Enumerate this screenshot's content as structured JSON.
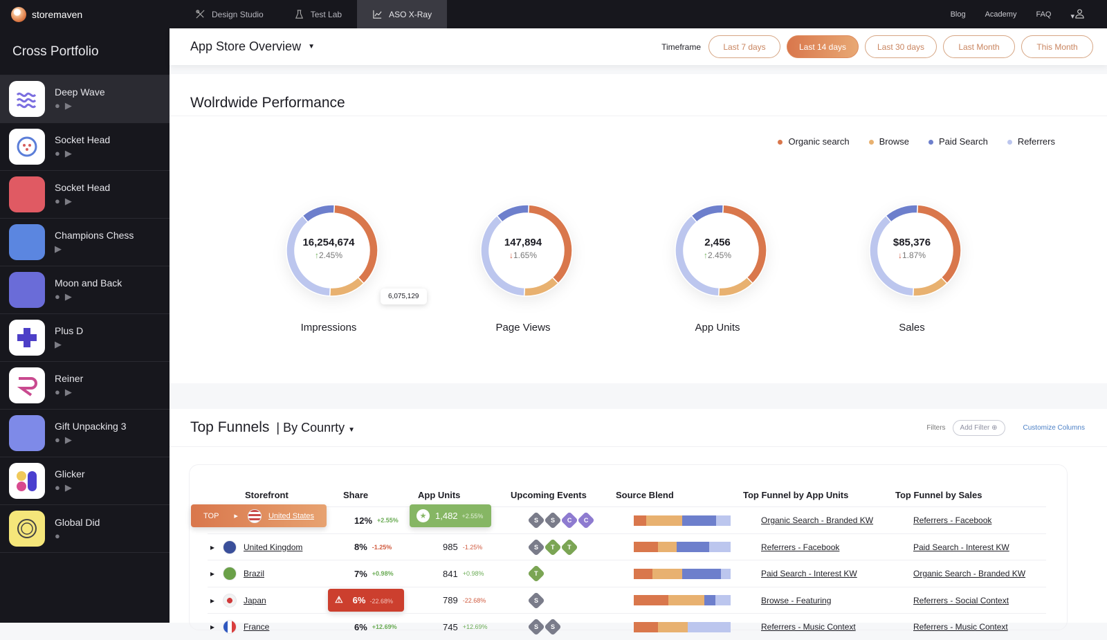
{
  "topbar": {
    "brand": "storemaven",
    "tabs": [
      {
        "label": "Design Studio",
        "icon": "design-studio-icon"
      },
      {
        "label": "Test Lab",
        "icon": "flask-icon"
      },
      {
        "label": "ASO X-Ray",
        "icon": "chart-line-icon",
        "active": true
      }
    ],
    "links": [
      "Blog",
      "Academy",
      "FAQ"
    ]
  },
  "sidebar": {
    "title": "Cross Portfolio",
    "apps": [
      {
        "name": "Deep Wave",
        "platforms": [
          "ios",
          "android"
        ],
        "active": true
      },
      {
        "name": "Socket Head",
        "platforms": [
          "ios",
          "android"
        ]
      },
      {
        "name": "Socket Head",
        "platforms": [
          "ios",
          "android"
        ]
      },
      {
        "name": "Champions Chess",
        "platforms": [
          "android"
        ]
      },
      {
        "name": "Moon and Back",
        "platforms": [
          "ios",
          "android"
        ]
      },
      {
        "name": "Plus D",
        "platforms": [
          "android"
        ]
      },
      {
        "name": "Reiner",
        "platforms": [
          "ios",
          "android"
        ]
      },
      {
        "name": "Gift Unpacking 3",
        "platforms": [
          "ios",
          "android"
        ]
      },
      {
        "name": "Glicker",
        "platforms": [
          "ios",
          "android"
        ]
      },
      {
        "name": "Global Did",
        "platforms": [
          "ios"
        ]
      }
    ]
  },
  "header": {
    "title": "App Store Overview",
    "timeframe_label": "Timeframe",
    "timeframes": [
      "Last 7 days",
      "Last 14 days",
      "Last 30 days",
      "Last Month",
      "This Month"
    ],
    "active_timeframe": "Last 14 days"
  },
  "performance": {
    "title": "Wolrdwide Performance",
    "tooltip": "6,075,129"
  },
  "chart_data": {
    "type": "pie",
    "legend": [
      {
        "name": "Organic search",
        "color": "#d9774c"
      },
      {
        "name": "Browse",
        "color": "#e8b170"
      },
      {
        "name": "Paid Search",
        "color": "#6d7fcc"
      },
      {
        "name": "Referrers",
        "color": "#bcc6ee"
      }
    ],
    "legend_position": "top-right",
    "charts": [
      {
        "label": "Impressions",
        "total": "16,254,674",
        "change": "2.45%",
        "direction": "up",
        "shares": [
          37,
          13,
          12,
          38
        ]
      },
      {
        "label": "Page Views",
        "total": "147,894",
        "change": "1.65%",
        "direction": "down",
        "shares": [
          37,
          13,
          12,
          38
        ]
      },
      {
        "label": "App Units",
        "total": "2,456",
        "change": "2.45%",
        "direction": "up",
        "shares": [
          37,
          13,
          12,
          38
        ]
      },
      {
        "label": "Sales",
        "total": "$85,376",
        "change": "1.87%",
        "direction": "down",
        "shares": [
          37,
          13,
          12,
          38
        ]
      }
    ]
  },
  "funnels": {
    "title": "Top Funnels",
    "subtitle": "By Counrty",
    "filters_label": "Filters",
    "add_filter": "Add Filter",
    "customize": "Customize Columns",
    "columns": [
      "Storefront",
      "Share",
      "App Units",
      "Upcoming Events",
      "Source Blend",
      "Top Funnel by App Units",
      "Top Funnel by Sales"
    ],
    "top_label": "TOP",
    "rows": [
      {
        "country": "United States",
        "share": "12%",
        "share_chg": "+2.55%",
        "units": "1,482",
        "units_chg": "+2.55%",
        "events": [
          "S",
          "S",
          "C",
          "C"
        ],
        "blend": [
          13,
          37,
          35,
          15
        ],
        "funnel_units": "Organic Search - Branded KW",
        "funnel_sales": "Referrers - Facebook"
      },
      {
        "country": "United Kingdom",
        "share": "8%",
        "share_chg": "-1.25%",
        "units": "985",
        "units_chg": "-1.25%",
        "events": [
          "S",
          "T",
          "T"
        ],
        "blend": [
          25,
          19,
          34,
          22
        ],
        "funnel_units": "Referrers - Facebook",
        "funnel_sales": "Paid Search - Interest KW"
      },
      {
        "country": "Brazil",
        "share": "7%",
        "share_chg": "+0.98%",
        "units": "841",
        "units_chg": "+0.98%",
        "events": [
          "T"
        ],
        "blend": [
          19,
          31,
          40,
          10
        ],
        "funnel_units": "Paid Search - Interest KW",
        "funnel_sales": "Organic Search - Branded KW"
      },
      {
        "country": "Japan",
        "share": "6%",
        "share_chg": "-22.68%",
        "units": "789",
        "units_chg": "-22.68%",
        "events": [
          "S"
        ],
        "blend": [
          36,
          37,
          11,
          16
        ],
        "funnel_units": "Browse - Featuring",
        "funnel_sales": "Referrers - Social Context"
      },
      {
        "country": "France",
        "share": "6%",
        "share_chg": "+12.69%",
        "units": "745",
        "units_chg": "+12.69%",
        "events": [
          "S",
          "S"
        ],
        "blend": [
          25,
          31,
          0,
          44
        ],
        "funnel_units": "Referrers - Music Context",
        "funnel_sales": "Referrers - Music Context"
      }
    ]
  }
}
